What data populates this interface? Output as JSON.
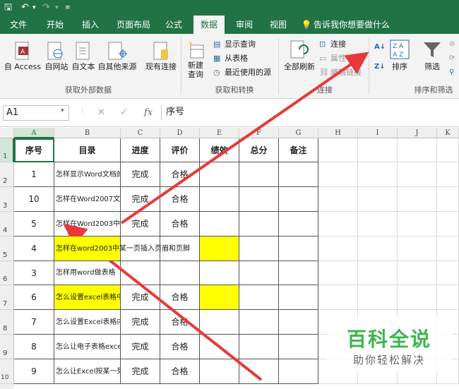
{
  "quick_access": {
    "save_icon": "save-icon",
    "undo_icon": "undo-icon",
    "redo_icon": "redo-icon",
    "customize_icon": "customize-icon"
  },
  "tabs": [
    "文件",
    "开始",
    "插入",
    "页面布局",
    "公式",
    "数据",
    "审阅",
    "视图"
  ],
  "active_tab": "数据",
  "tell_me": "告诉我你想要做什么",
  "ribbon": {
    "access": "自 Access",
    "web": "自网站",
    "text": "自文本",
    "other": "自其他来源",
    "existing": "现有连接",
    "new_query_1": "新建",
    "new_query_2": "查询",
    "show_queries": "显示查询",
    "from_table": "从表格",
    "recent_sources": "最近使用的源",
    "refresh_all": "全部刷新",
    "connections": "连接",
    "properties": "属性",
    "edit_links": "编辑链接",
    "sort": "排序",
    "filter": "筛选",
    "group_external": "获取外部数据",
    "group_transform": "获取和转换",
    "group_connections": "连接",
    "group_sort": "排序和筛选"
  },
  "formula_bar": {
    "name_box": "A1",
    "fx": "fx",
    "content": "序号"
  },
  "columns": [
    "A",
    "B",
    "C",
    "D",
    "E",
    "F",
    "G",
    "H",
    "I",
    "J",
    "K"
  ],
  "row_numbers": [
    "1",
    "2",
    "3",
    "4",
    "5",
    "6",
    "7",
    "8",
    "9",
    "10"
  ],
  "table": {
    "headers": [
      "序号",
      "目录",
      "进度",
      "评价",
      "绩效",
      "总分",
      "备注"
    ],
    "rows": [
      [
        "1",
        "怎样显示Word文档的",
        "完成",
        "合格",
        "",
        "",
        ""
      ],
      [
        "10",
        "怎样在Word2007文档",
        "完成",
        "合格",
        "",
        "",
        ""
      ],
      [
        "5",
        "怎样在Word2003中",
        "完成",
        "合格",
        "",
        "",
        ""
      ],
      [
        "4",
        "怎样在word2003中某一页插入页眉和页脚",
        "",
        "",
        "",
        "",
        ""
      ],
      [
        "3",
        "怎样用word做表格",
        "",
        "",
        "",
        "",
        ""
      ],
      [
        "6",
        "怎么设置excel表格中",
        "完成",
        "合格",
        "",
        "",
        ""
      ],
      [
        "7",
        "怎么设置Excel表格内",
        "完成",
        "合格",
        "",
        "",
        ""
      ],
      [
        "8",
        "怎么让电子表格exce",
        "完成",
        "合格",
        "",
        "",
        ""
      ],
      [
        "9",
        "怎么让Excel按某一列",
        "完成",
        "合格",
        "",
        "",
        ""
      ]
    ]
  },
  "highlight_color": "#ffff00",
  "accent_color": "#217346",
  "arrow_color": "#e8393a",
  "watermark": {
    "title": "百科全说",
    "subtitle": "助你轻松解决"
  }
}
